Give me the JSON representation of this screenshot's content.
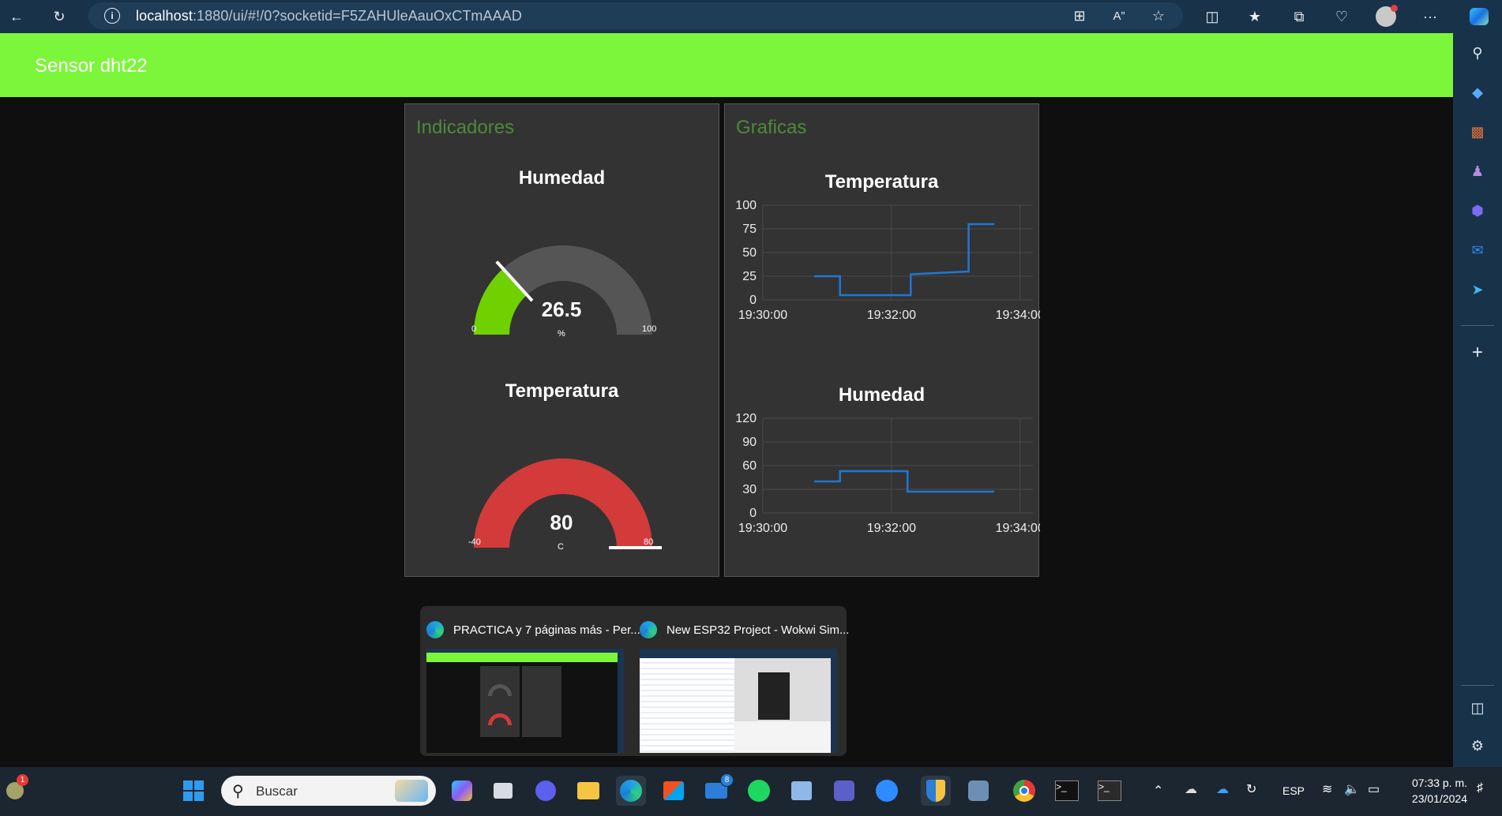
{
  "browser": {
    "url_host": "localhost",
    "url_rest": ":1880/ui/#!/0?socketid=F5ZAHUleAauOxCTmAAAD"
  },
  "dashboard": {
    "title": "Sensor dht22",
    "indicators_title": "Indicadores",
    "charts_title": "Graficas",
    "gauges": [
      {
        "title": "Humedad",
        "value": "26.5",
        "unit": "%",
        "min": "0",
        "max": "100",
        "level": 0.265,
        "color": "#6fd100"
      },
      {
        "title": "Temperatura",
        "value": "80",
        "unit": "C",
        "min": "-40",
        "max": "80",
        "level": 1.0,
        "color": "#d33a3a"
      }
    ]
  },
  "chart_data": [
    {
      "type": "line",
      "title": "Temperatura",
      "x_ticks": [
        "19:30:00",
        "19:32:00",
        "19:34:00"
      ],
      "y_ticks": [
        "100",
        "75",
        "50",
        "25",
        "0"
      ],
      "ylim": [
        0,
        100
      ],
      "xlim_minutes": [
        0,
        4.2
      ],
      "series": [
        {
          "color": "#1f77d4",
          "x": [
            0.8,
            1.2,
            1.2,
            2.3,
            2.3,
            3.2,
            3.2,
            3.6
          ],
          "y": [
            25,
            25,
            5,
            5,
            27,
            30,
            80,
            80
          ]
        }
      ]
    },
    {
      "type": "line",
      "title": "Humedad",
      "x_ticks": [
        "19:30:00",
        "19:32:00",
        "19:34:00"
      ],
      "y_ticks": [
        "120",
        "90",
        "60",
        "30",
        "0"
      ],
      "ylim": [
        0,
        120
      ],
      "xlim_minutes": [
        0,
        4.2
      ],
      "series": [
        {
          "color": "#1f77d4",
          "x": [
            0.8,
            1.2,
            1.2,
            2.25,
            2.25,
            3.6
          ],
          "y": [
            40,
            40,
            53,
            53,
            27,
            27
          ]
        }
      ]
    }
  ],
  "previews": [
    {
      "label": "PRACTICA y 7 páginas más - Per..."
    },
    {
      "label": "New ESP32 Project - Wokwi Sim..."
    }
  ],
  "taskbar": {
    "search_placeholder": "Buscar",
    "lang": "ESP",
    "time": "07:33 p. m.",
    "date": "23/01/2024",
    "mail_badge": "8",
    "notif_badge": "1"
  }
}
